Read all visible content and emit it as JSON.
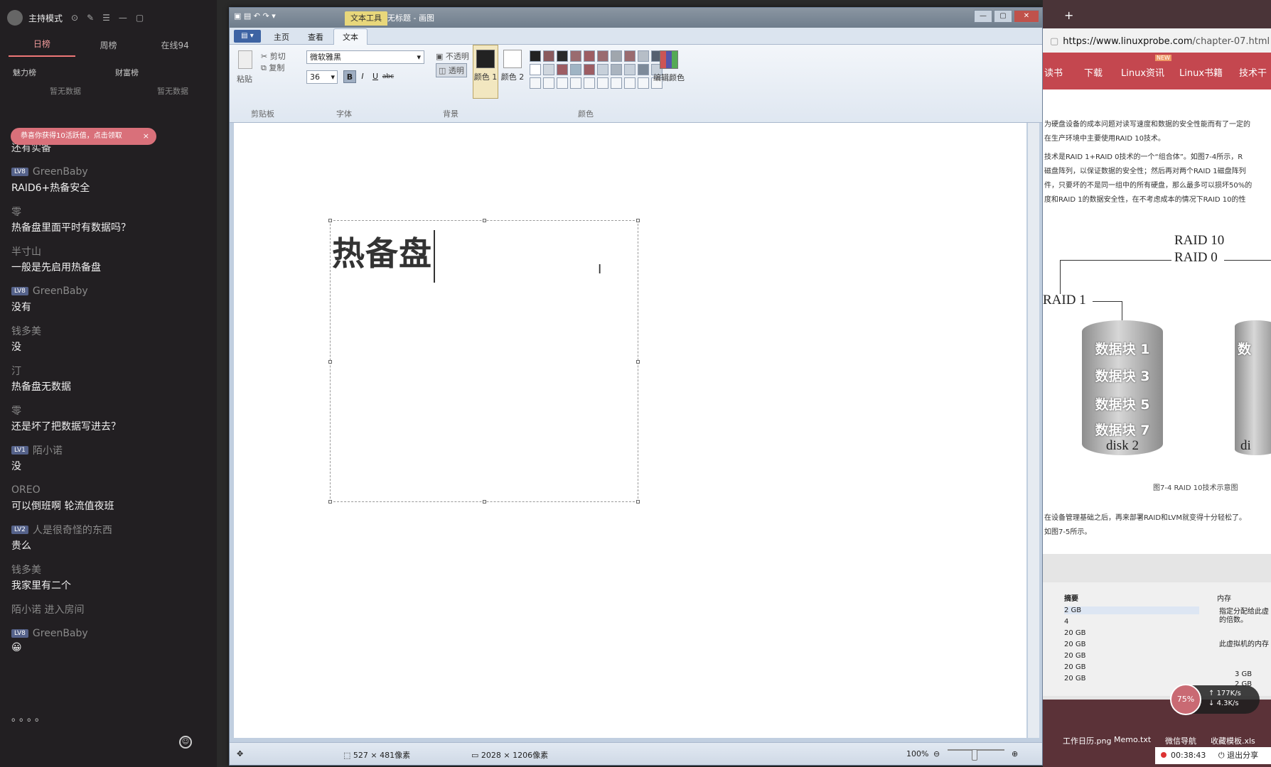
{
  "chat": {
    "header": {
      "mode": "主持模式",
      "online": "在线94"
    },
    "tabs": [
      "日榜",
      "周榜",
      "在线94"
    ],
    "ranks": [
      {
        "label": "魅力榜",
        "empty": "暂无数据"
      },
      {
        "label": "财富榜",
        "empty": "暂无数据"
      }
    ],
    "notice": "恭喜你获得10活跃值，点击领取",
    "prev_text": "还有实备",
    "messages": [
      {
        "user": "GreenBaby",
        "level": "LV8",
        "text": "RAID6+热备安全"
      },
      {
        "user": "零",
        "level": "",
        "text": "热备盘里面平时有数据吗？"
      },
      {
        "user": "半寸山",
        "level": "",
        "text": "一般是先启用热备盘"
      },
      {
        "user": "GreenBaby",
        "level": "LV8",
        "text": "没有"
      },
      {
        "user": "钱多美",
        "level": "",
        "text": "没"
      },
      {
        "user": "汀",
        "level": "",
        "text": "热备盘无数据"
      },
      {
        "user": "零",
        "level": "",
        "text": "还是坏了把数据写进去？"
      },
      {
        "user": "陌小诺",
        "level": "LV1",
        "text": "没"
      },
      {
        "user": "OREO",
        "level": "",
        "text": "可以倒班啊 轮流值夜班"
      },
      {
        "user": "人是很奇怪的东西",
        "level": "LV2",
        "text": "贵么"
      },
      {
        "user": "钱多美",
        "level": "",
        "text": "我家里有二个"
      },
      {
        "user": "陌小诺 进入房间",
        "level": "",
        "text": ""
      },
      {
        "user": "GreenBaby",
        "level": "LV8",
        "text": "😀"
      }
    ],
    "typing_dots": "。。。。"
  },
  "paint": {
    "context_tab": "文本工具",
    "title": "无标题 - 画图",
    "menu_btn": "▤ ▾",
    "tabs": [
      "主页",
      "查看",
      "文本"
    ],
    "clipboard": {
      "paste": "粘贴",
      "cut": "剪切",
      "copy": "复制",
      "group": "剪贴板"
    },
    "font": {
      "name": "微软雅黑",
      "size": "36",
      "group": "字体"
    },
    "background": {
      "opaque": "不透明",
      "transparent": "透明",
      "group": "背景"
    },
    "colors": {
      "color1": "颜色 1",
      "color2": "颜色 2",
      "edit": "编辑颜色",
      "group": "颜色"
    },
    "palette": [
      "#222222",
      "#8a5a5e",
      "#2a2a2a",
      "#9a6b6f",
      "#9d5d63",
      "#9a6b6f",
      "#a0a6ad",
      "#9a6b6f",
      "#b6bec7",
      "#556070",
      "#ffffff",
      "#cfd6de",
      "#9d5d63",
      "#9fb4c4",
      "#9d5d63",
      "#c7d0da",
      "#aab4bf",
      "#c7d0da",
      "#7d8a99",
      "#c7d0da",
      "#f4f6f9",
      "#f4f6f9",
      "#f4f6f9",
      "#f4f6f9",
      "#f4f6f9",
      "#f4f6f9",
      "#f4f6f9",
      "#f4f6f9",
      "#f4f6f9",
      "#f4f6f9"
    ],
    "canvas_text": "热备盘",
    "status": {
      "selection": "527 × 481像素",
      "image_size": "2028 × 1206像素",
      "zoom": "100%"
    }
  },
  "browser": {
    "url_host": "https://www.linuxprobe.com",
    "url_path": "/chapter-07.html",
    "nav": [
      "读书",
      "下载",
      "Linux资讯",
      "Linux书籍",
      "技术干"
    ],
    "nav_badge": "NEW",
    "paragraphs": [
      "为硬盘设备的成本问题对读写速度和数据的安全性能而有了一定的",
      "在生产环境中主要使用RAID 10技术。",
      "技术是RAID 1+RAID 0技术的一个“组合体”。如图7-4所示，R",
      "磁盘阵列，以保证数据的安全性；然后再对两个RAID 1磁盘阵列",
      "件，只要坏的不是同一组中的所有硬盘，那么最多可以损坏50%的",
      "度和RAID 1的数据安全性，在不考虑成本的情况下RAID 10的性"
    ],
    "figure": {
      "raid10": "RAID 10",
      "raid0": "RAID 0",
      "raid1": "RAID 1",
      "blocks": [
        "数据块 1",
        "数据块 3",
        "数据块 5",
        "数据块 7"
      ],
      "disk": "disk 2",
      "right_partial": "数",
      "right_disk": "di",
      "caption": "图7-4  RAID 10技术示意图"
    },
    "after_para": [
      "在设备管理基础之后，再来部署RAID和LVM就变得十分轻松了。",
      "如图7-5所示。"
    ],
    "vm": {
      "header_col": "摘要",
      "memory_label": "内存",
      "rows": [
        "2 GB",
        "4",
        "20 GB",
        "20 GB",
        "20 GB",
        "20 GB",
        "20 GB"
      ],
      "note1": "指定分配给此虚",
      "note1b": "的倍数。",
      "note2": "此虚拟机的内存",
      "right_vals": [
        "3 GB",
        "2 GB"
      ]
    },
    "desktop": [
      {
        "name": "工作日历.png"
      },
      {
        "name": "Memo.txt"
      },
      {
        "name": "微信导航"
      },
      {
        "name": "收藏模板.xls"
      }
    ],
    "speed": {
      "percent": "75%",
      "up": "177K/s",
      "down": "4.3K/s"
    },
    "timer": "00:38:43",
    "share_exit": "退出分享"
  }
}
